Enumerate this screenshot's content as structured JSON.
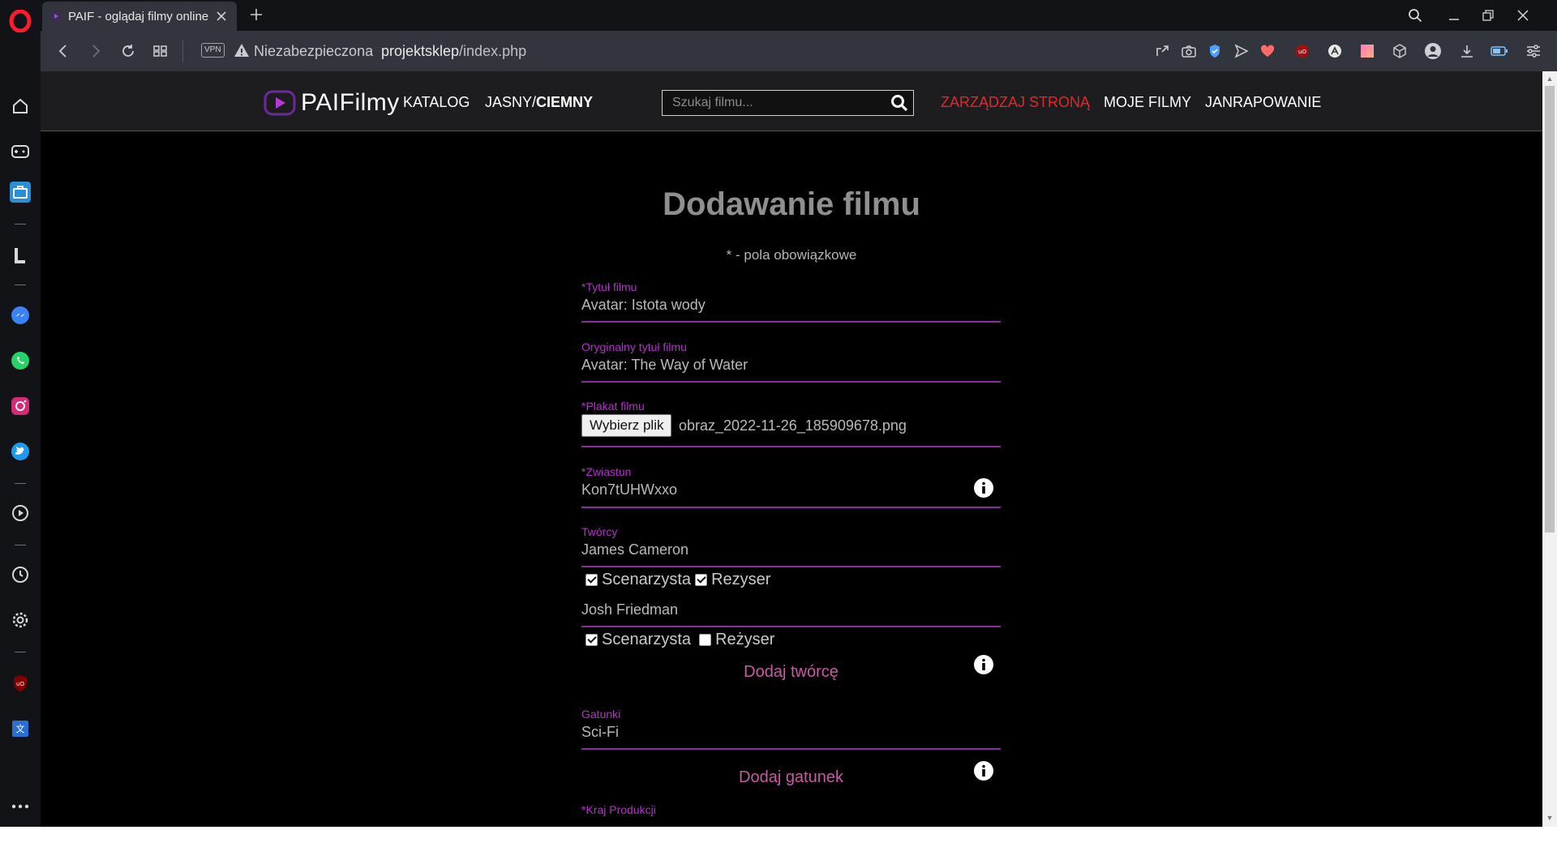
{
  "browser": {
    "tab_title": "PAIF - oglądaj filmy online",
    "new_tab": "+",
    "vpn": "VPN",
    "security_label": "Niezabezpieczona",
    "url_host": "projektsklep",
    "url_path": "/index.php"
  },
  "site": {
    "logo_text": "PAIFilmy",
    "nav": {
      "catalog": "KATALOG",
      "theme_light": "JASNY/",
      "theme_dark": "CIEMNY",
      "manage": "ZARZĄDZAJ STRONĄ",
      "my_films": "MOJE FILMY",
      "ranking": "JANRAPOWANIE"
    },
    "search_placeholder": "Szukaj filmu..."
  },
  "form": {
    "title": "Dodawanie filmu",
    "note": "* - pola obowiązkowe",
    "title_label": "*Tytuł filmu",
    "title_value": "Avatar: Istota wody",
    "orig_label": "Oryginalny tytuł filmu",
    "orig_value": "Avatar: The Way of Water",
    "poster_label": "*Plakat filmu",
    "poster_button": "Wybierz plik",
    "poster_file": "obraz_2022-11-26_185909678.png",
    "trailer_label": "*Zwiastun",
    "trailer_value": "Kon7tUHWxxo",
    "creators_label": "Twórcy",
    "creator1_name": "James Cameron",
    "creator1_role1": "Scenarzysta",
    "creator1_role2": "Rezyser",
    "creator2_name": "Josh Friedman",
    "creator2_role1": "Scenarzysta",
    "creator2_role2": "Reżyser",
    "add_creator": "Dodaj twórcę",
    "genres_label": "Gatunki",
    "genre1": "Sci-Fi",
    "add_genre": "Dodaj gatunek",
    "country_label": "*Kraj Produkcji"
  },
  "colors": {
    "accent_purple": "#8a2ca6",
    "label_purple": "#b431c9",
    "nav_active_red": "#e8262a",
    "add_pink": "#c85aa6"
  }
}
